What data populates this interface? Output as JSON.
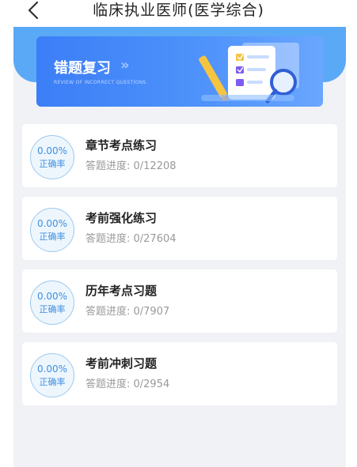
{
  "header": {
    "title": "临床执业医师(医学综合)"
  },
  "banner": {
    "title": "错题复习",
    "arrows": "»",
    "subtitle": "REVIEW OF INCORRECT QUESTIONS"
  },
  "cards": [
    {
      "rate": "0.00%",
      "rate_label": "正确率",
      "title": "章节考点练习",
      "progress": "答题进度: 0/12208"
    },
    {
      "rate": "0.00%",
      "rate_label": "正确率",
      "title": "考前强化练习",
      "progress": "答题进度: 0/27604"
    },
    {
      "rate": "0.00%",
      "rate_label": "正确率",
      "title": "历年考点习题",
      "progress": "答题进度: 0/7907"
    },
    {
      "rate": "0.00%",
      "rate_label": "正确率",
      "title": "考前冲刺习题",
      "progress": "答题进度: 0/2954"
    }
  ],
  "colors": {
    "accent": "#3d8fe0",
    "banner": "#3b7ef7",
    "header_band": "#5aa9f6",
    "page_bg": "#f1f2f6"
  }
}
